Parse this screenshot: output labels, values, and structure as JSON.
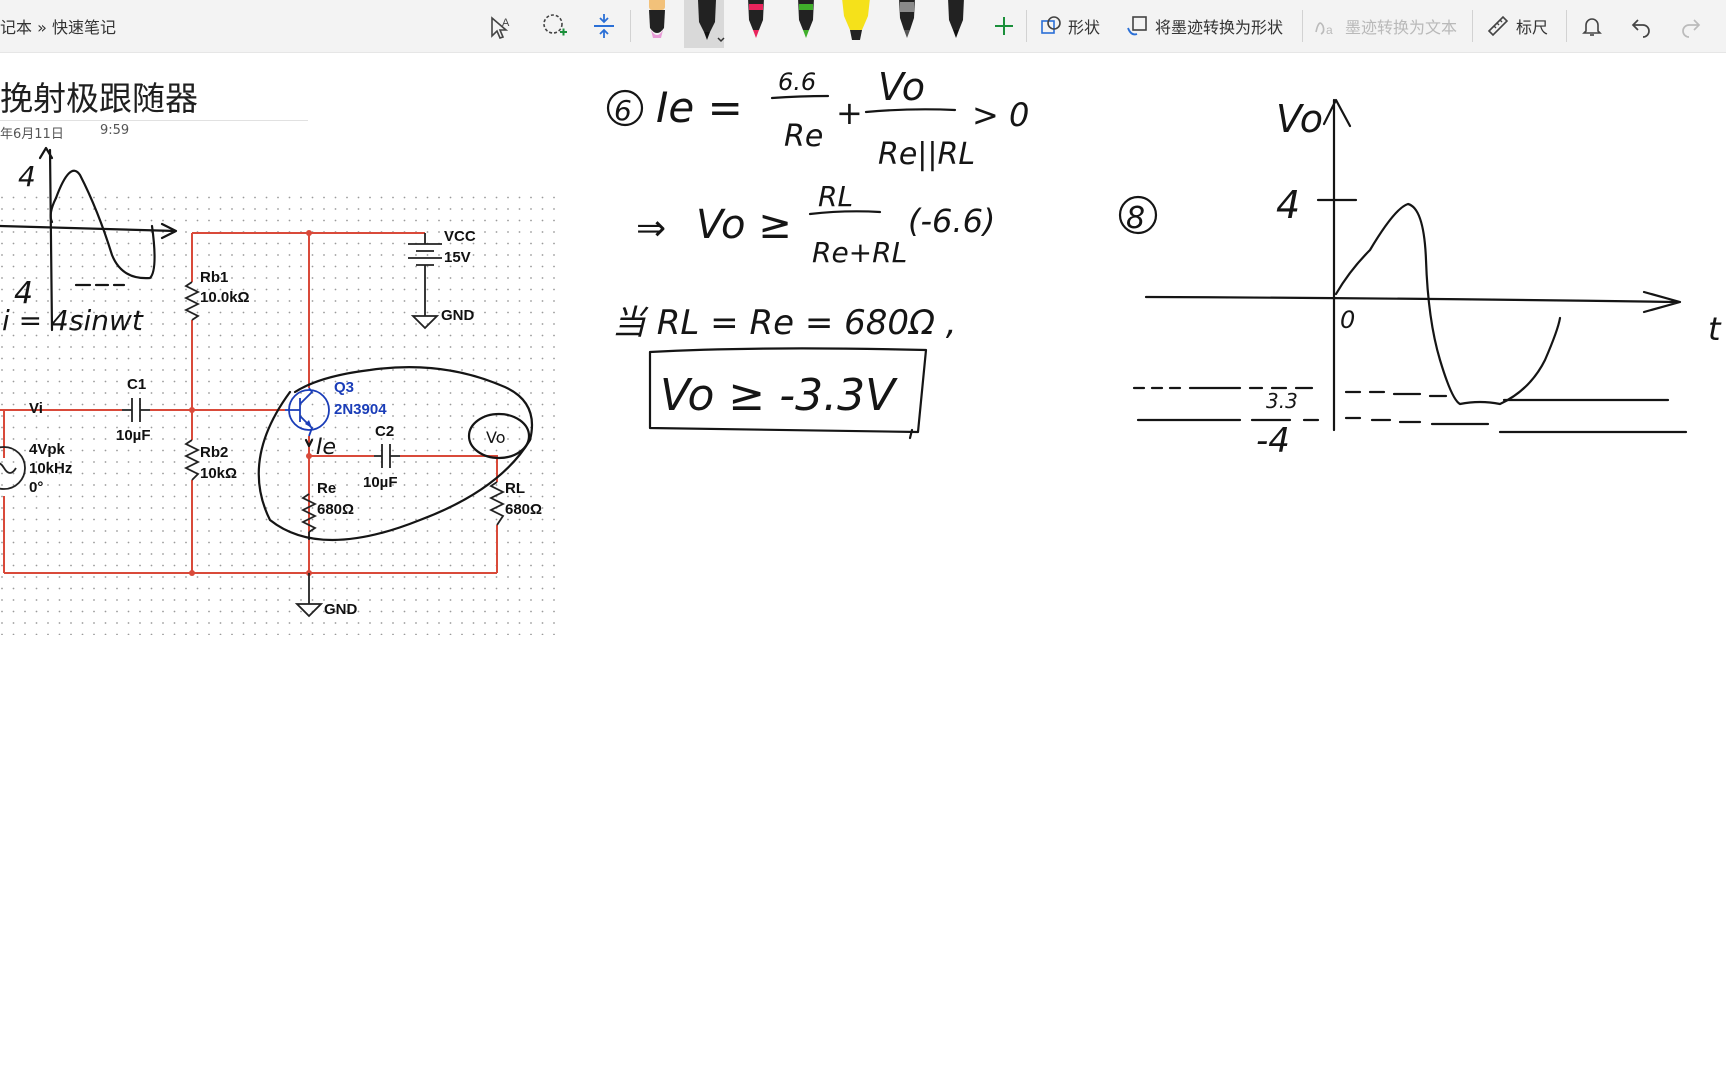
{
  "breadcrumb": "记本 » 快速笔记",
  "toolbar": {
    "shapes_label": "形状",
    "ink_to_shape_label": "将墨迹转换为形状",
    "ink_to_text_label": "墨迹转换为文本",
    "ruler_label": "标尺"
  },
  "page": {
    "title": "挽射极跟随器",
    "date": "年6月11日",
    "time": "9:59"
  },
  "circuit": {
    "vcc_label": "VCC",
    "vcc_value": "15V",
    "gnd_label_top": "GND",
    "gnd_label_bottom": "GND",
    "rb1_name": "Rb1",
    "rb1_value": "10.0kΩ",
    "rb2_name": "Rb2",
    "rb2_value": "10kΩ",
    "c1_name": "C1",
    "c1_value": "10µF",
    "c2_name": "C2",
    "c2_value": "10µF",
    "vi_label": "Vi",
    "source_amp": "4Vpk",
    "source_freq": "10kHz",
    "source_phase": "0°",
    "q_name": "Q3",
    "q_model": "2N3904",
    "re_name": "Re",
    "re_value": "680Ω",
    "rl_name": "RL",
    "rl_value": "680Ω"
  },
  "handwriting": {
    "left_top_4": "4",
    "left_mid_4": "4",
    "vi_formula": "i = 4sinwt",
    "ie_label": "Ie",
    "vo_circled": "Vo",
    "step6_num": "6",
    "eq1_lhs": "Ie =",
    "eq1_num1": "6.6",
    "eq1_den1": "Re",
    "eq1_plus": "+",
    "eq1_num2": "Vo",
    "eq1_den2": "Re||RL",
    "eq1_rhs": "> 0",
    "eq2_arrow": "⇒",
    "eq2_lhs": "Vo ≥",
    "eq2_num": "RL",
    "eq2_den": "Re+RL",
    "eq2_rhs": "(-6.6)",
    "eq3": "当 RL = Re = 680Ω ,",
    "boxed": "Vo ≥ -3.3V",
    "step8_num": "8",
    "graph_vo": "Vo",
    "graph_4": "4",
    "graph_0": "0",
    "graph_33": "3.3",
    "graph_neg4": "-4",
    "graph_t": "t"
  }
}
